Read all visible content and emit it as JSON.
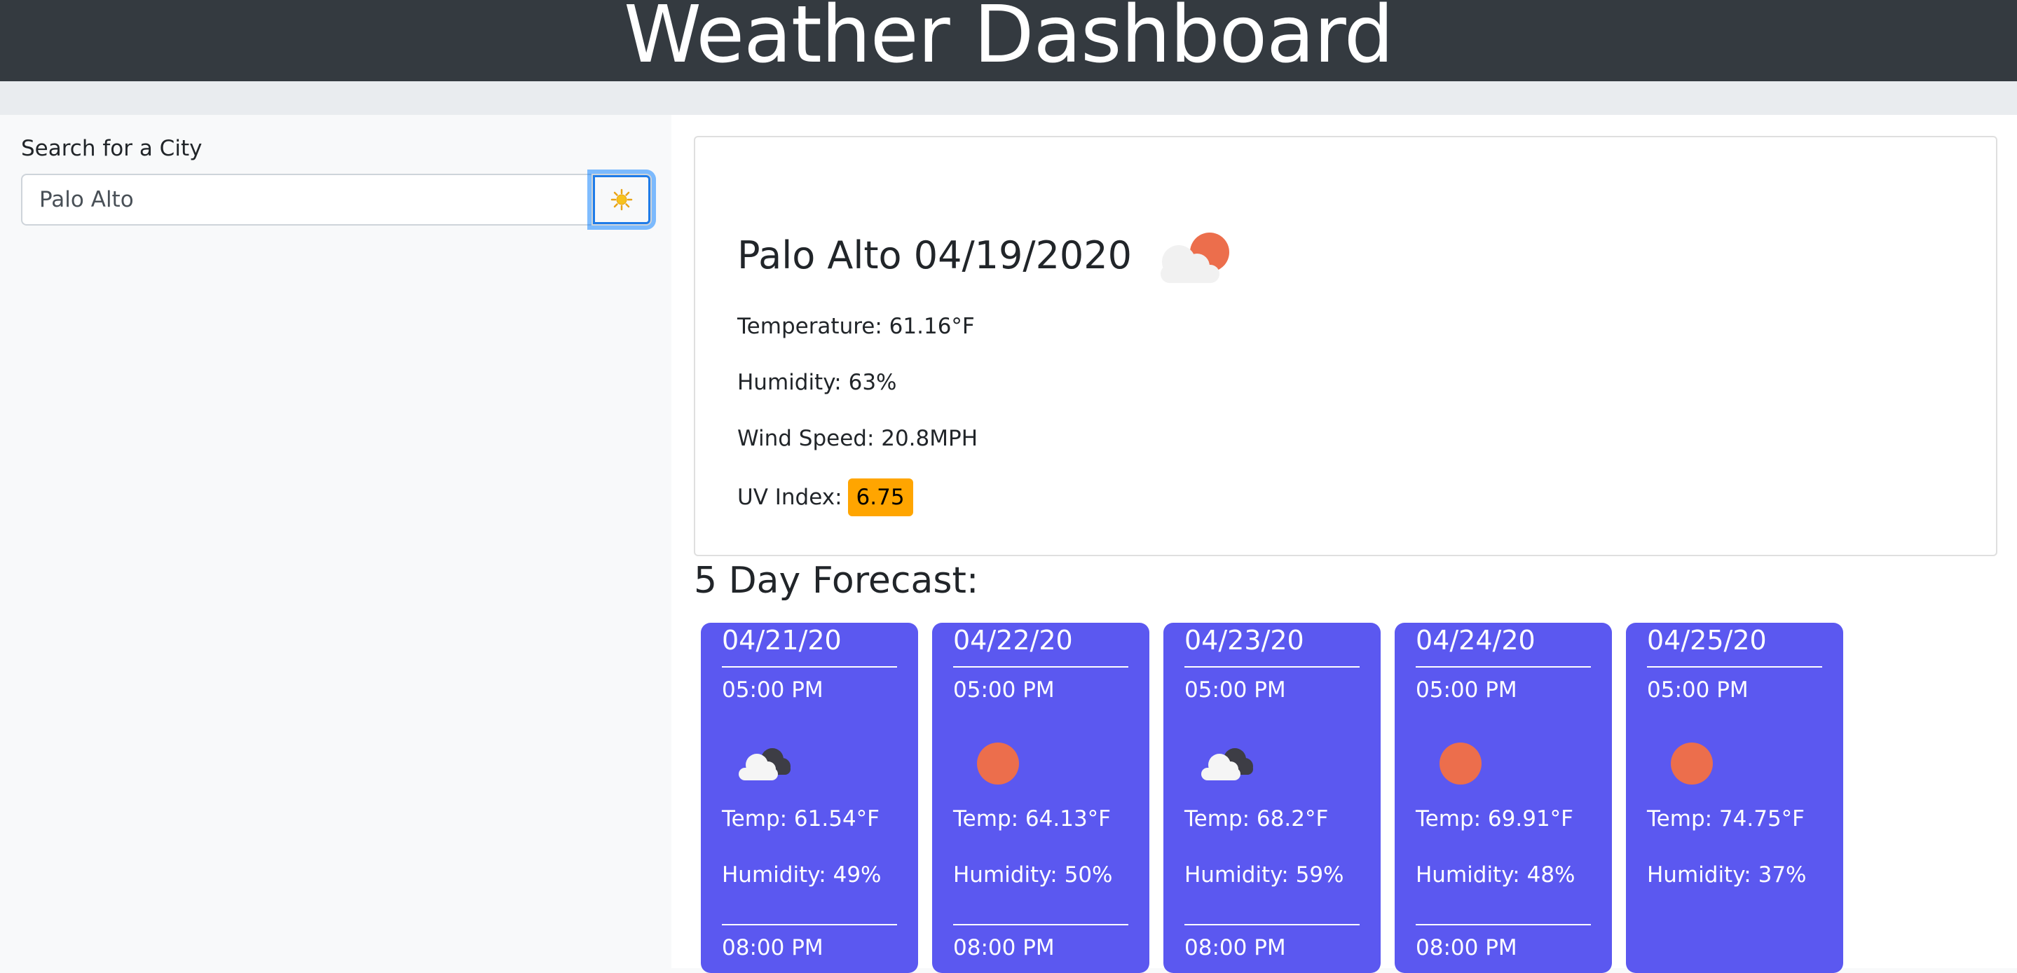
{
  "header": {
    "title": "Weather Dashboard"
  },
  "search": {
    "label": "Search for a City",
    "value": "Palo Alto",
    "button_icon": "sun-icon"
  },
  "current": {
    "title": "Palo Alto 04/19/2020",
    "icon": "partly-cloudy-icon",
    "temperature": "Temperature: 61.16°F",
    "humidity": "Humidity: 63%",
    "wind": "Wind Speed: 20.8MPH",
    "uv_label": "UV Index:",
    "uv_value": "6.75",
    "uv_color": "#ffa500"
  },
  "forecast": {
    "title": "5 Day Forecast:",
    "card_color": "#5b58f0",
    "days": [
      {
        "date": "04/21/20",
        "time": "05:00 PM",
        "icon": "cloud-icon",
        "temp": "Temp: 61.54°F",
        "humidity": "Humidity: 49%",
        "next_time": "08:00 PM"
      },
      {
        "date": "04/22/20",
        "time": "05:00 PM",
        "icon": "sun-icon",
        "temp": "Temp: 64.13°F",
        "humidity": "Humidity: 50%",
        "next_time": "08:00 PM"
      },
      {
        "date": "04/23/20",
        "time": "05:00 PM",
        "icon": "cloud-icon",
        "temp": "Temp: 68.2°F",
        "humidity": "Humidity: 59%",
        "next_time": "08:00 PM"
      },
      {
        "date": "04/24/20",
        "time": "05:00 PM",
        "icon": "sun-icon",
        "temp": "Temp: 69.91°F",
        "humidity": "Humidity: 48%",
        "next_time": "08:00 PM"
      },
      {
        "date": "04/25/20",
        "time": "05:00 PM",
        "icon": "sun-icon",
        "temp": "Temp: 74.75°F",
        "humidity": "Humidity: 37%",
        "next_time": ""
      }
    ]
  }
}
